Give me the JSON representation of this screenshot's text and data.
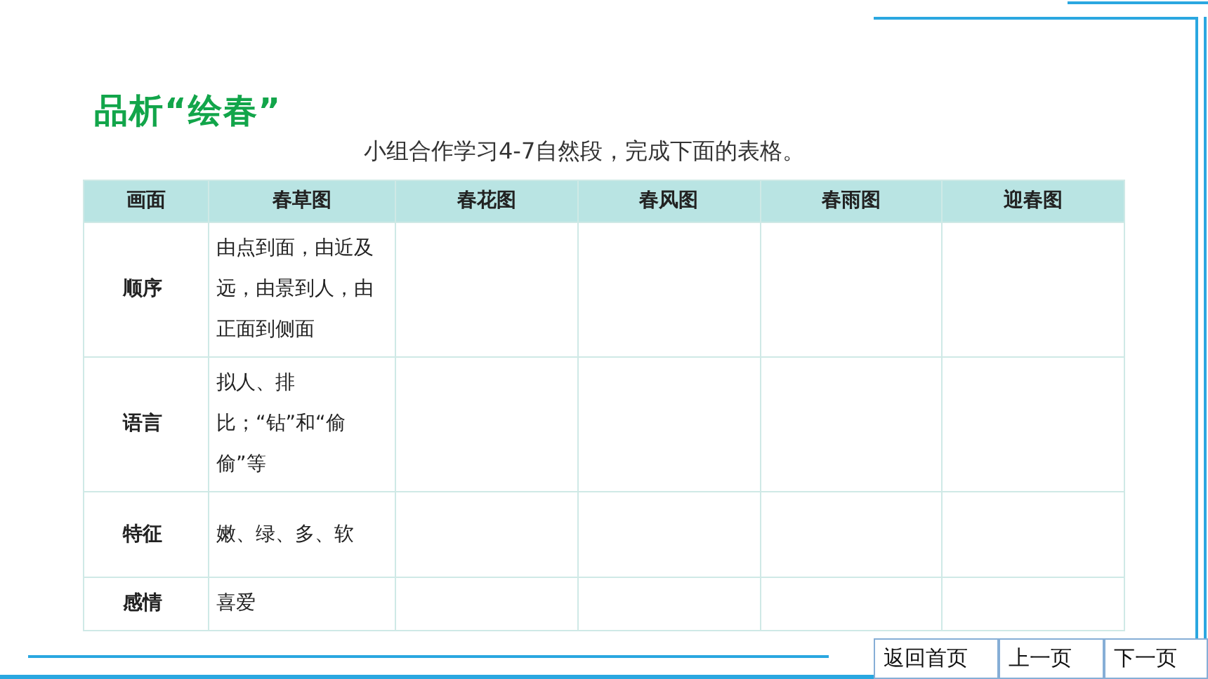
{
  "title": "品析“绘春”",
  "instruction": "小组合作学习4-7自然段，完成下面的表格。",
  "table": {
    "columns": [
      "画面",
      "春草图",
      "春花图",
      "春风图",
      "春雨图",
      "迎春图"
    ],
    "rows": [
      {
        "label": "顺序",
        "cells": [
          "由点到面，由近及远，由景到人，由正面到侧面"
        ]
      },
      {
        "label": "语言",
        "cells": [
          "拟人、排比；“钻”和“偷偷”等"
        ]
      },
      {
        "label": "特征",
        "cells": [
          "嫩、绿、多、软"
        ]
      },
      {
        "label": "感情",
        "cells": [
          "喜爱"
        ]
      }
    ]
  },
  "nav_buttons": [
    "返回首页",
    "上一页",
    "下一页"
  ]
}
